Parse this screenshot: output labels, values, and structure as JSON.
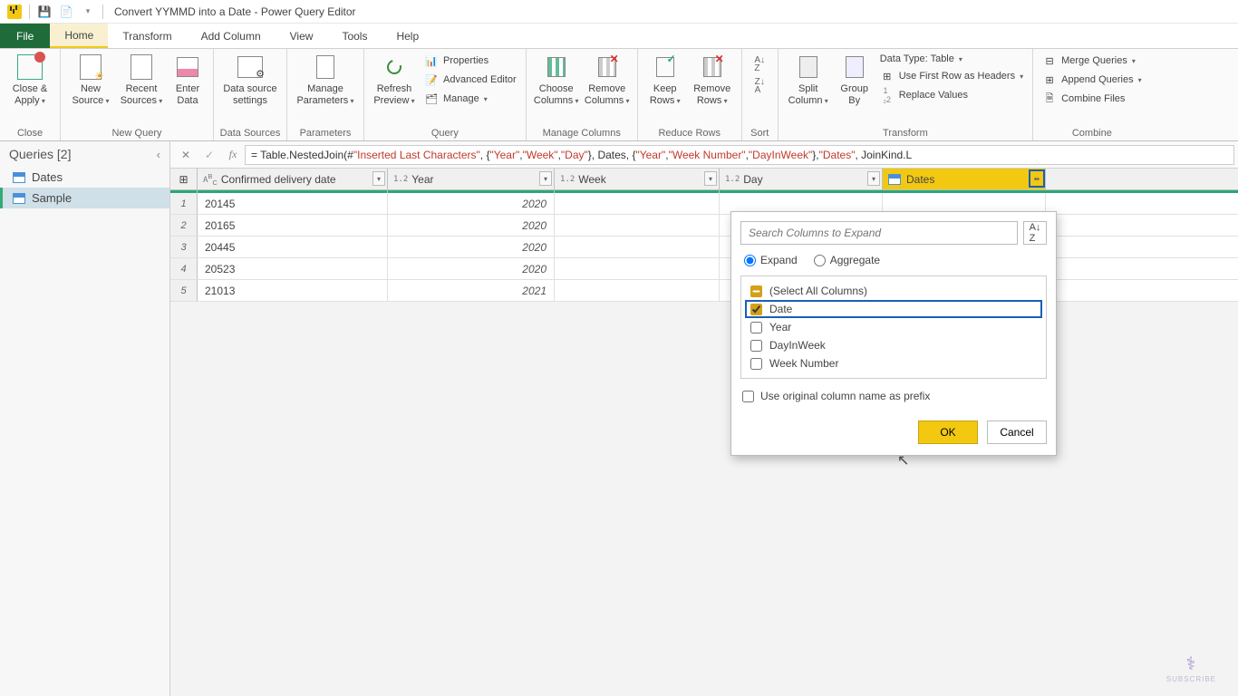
{
  "window": {
    "title": "Convert YYMMD into a Date - Power Query Editor"
  },
  "tabs": {
    "file": "File",
    "home": "Home",
    "transform": "Transform",
    "add_column": "Add Column",
    "view": "View",
    "tools": "Tools",
    "help": "Help"
  },
  "ribbon": {
    "close": {
      "label": "Close &\nApply",
      "group": "Close"
    },
    "new_source": "New\nSource",
    "recent_sources": "Recent\nSources",
    "enter_data": "Enter\nData",
    "group_new_query": "New Query",
    "data_source_settings": "Data source\nsettings",
    "group_data_sources": "Data Sources",
    "manage_parameters": "Manage\nParameters",
    "group_parameters": "Parameters",
    "refresh_preview": "Refresh\nPreview",
    "properties": "Properties",
    "advanced_editor": "Advanced Editor",
    "manage": "Manage",
    "group_query": "Query",
    "choose_columns": "Choose\nColumns",
    "remove_columns": "Remove\nColumns",
    "group_manage_columns": "Manage Columns",
    "keep_rows": "Keep\nRows",
    "remove_rows": "Remove\nRows",
    "group_reduce_rows": "Reduce Rows",
    "group_sort": "Sort",
    "split_column": "Split\nColumn",
    "group_by": "Group\nBy",
    "data_type": "Data Type: Table",
    "first_row_headers": "Use First Row as Headers",
    "replace_values": "Replace Values",
    "group_transform": "Transform",
    "merge_queries": "Merge Queries",
    "append_queries": "Append Queries",
    "combine_files": "Combine Files",
    "group_combine": "Combine"
  },
  "queries": {
    "header": "Queries [2]",
    "items": [
      {
        "name": "Dates",
        "selected": false
      },
      {
        "name": "Sample",
        "selected": true
      }
    ]
  },
  "formula": {
    "prefix": "= Table.NestedJoin(#",
    "s1": "\"Inserted Last Characters\"",
    "mid1": ", {",
    "s2": "\"Year\"",
    "c": ", ",
    "s3": "\"Week\"",
    "s4": "\"Day\"",
    "mid2": "}, Dates, {",
    "s5": "\"Year\"",
    "s6": "\"Week Number\"",
    "s7": "\"DayInWeek\"",
    "mid3": "}, ",
    "s8": "\"Dates\"",
    "suffix": ", JoinKind.L"
  },
  "columns": {
    "confirmed": "Confirmed delivery date",
    "year": "Year",
    "week": "Week",
    "day": "Day",
    "dates": "Dates"
  },
  "rows": [
    {
      "n": "1",
      "confirmed": "20145",
      "year": "2020"
    },
    {
      "n": "2",
      "confirmed": "20165",
      "year": "2020"
    },
    {
      "n": "3",
      "confirmed": "20445",
      "year": "2020"
    },
    {
      "n": "4",
      "confirmed": "20523",
      "year": "2020"
    },
    {
      "n": "5",
      "confirmed": "21013",
      "year": "2021"
    }
  ],
  "expand": {
    "search_placeholder": "Search Columns to Expand",
    "opt_expand": "Expand",
    "opt_aggregate": "Aggregate",
    "select_all": "(Select All Columns)",
    "col_date": "Date",
    "col_year": "Year",
    "col_dayinweek": "DayInWeek",
    "col_weeknumber": "Week Number",
    "use_prefix": "Use original column name as prefix",
    "ok": "OK",
    "cancel": "Cancel"
  },
  "subscribe": "SUBSCRIBE"
}
